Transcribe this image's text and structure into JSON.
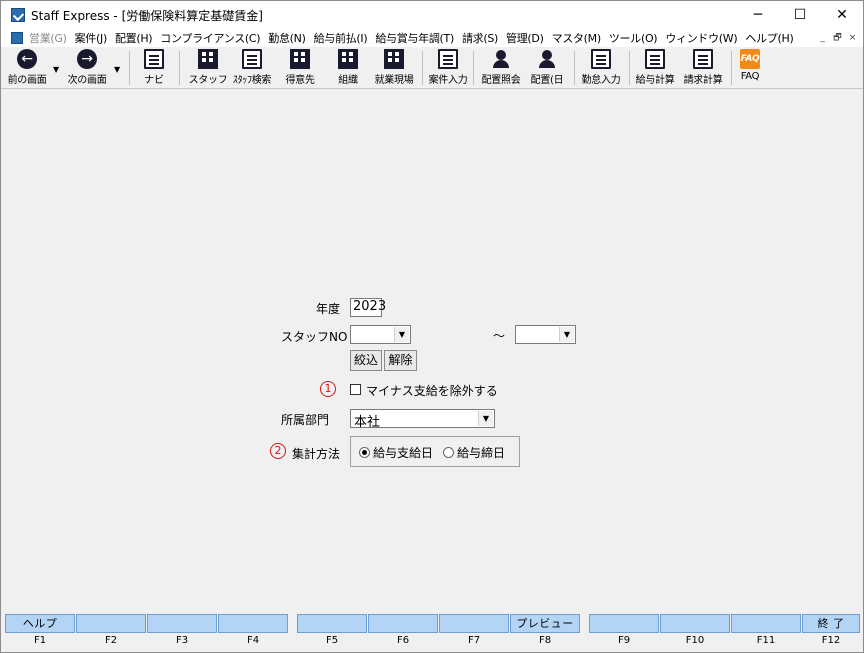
{
  "window": {
    "title": "Staff Express - [労働保険料算定基礎賃金]"
  },
  "window_controls": {
    "minimize": "─",
    "maximize": "☐",
    "close": "✕"
  },
  "mdi_controls": {
    "minimize": "_",
    "restore": "🗗",
    "close": "×"
  },
  "menu": {
    "items": [
      {
        "label": "営業(G)",
        "disabled": true
      },
      {
        "label": "案件(J)"
      },
      {
        "label": "配置(H)"
      },
      {
        "label": "コンプライアンス(C)"
      },
      {
        "label": "勤怠(N)"
      },
      {
        "label": "給与前払(I)"
      },
      {
        "label": "給与賞与年調(T)"
      },
      {
        "label": "請求(S)"
      },
      {
        "label": "管理(D)"
      },
      {
        "label": "マスタ(M)"
      },
      {
        "label": "ツール(O)"
      },
      {
        "label": "ウィンドウ(W)"
      },
      {
        "label": "ヘルプ(H)"
      }
    ]
  },
  "toolbar": {
    "back": "前の画面",
    "forward": "次の画面",
    "navi": "ナビ",
    "staff": "スタッフ",
    "staff_search": "ｽﾀｯﾌ検索",
    "client": "得意先",
    "org": "組織",
    "worksite": "就業現場",
    "case_input": "案件入力",
    "assign_view": "配置照会",
    "assign_day": "配置(日",
    "attendance_input": "勤怠入力",
    "payroll_calc": "給与計算",
    "billing_calc": "請求計算",
    "faq": "FAQ",
    "faq_icon_text": "FAQ",
    "back_icon": "←",
    "forward_icon": "→",
    "dropdown_arrow": "▼"
  },
  "form": {
    "year_label": "年度",
    "year_value": "2023",
    "staff_no_label": "スタッフNO",
    "staff_no_from": "",
    "staff_no_to": "",
    "range_sep": "～",
    "filter_button": "絞込",
    "clear_button": "解除",
    "marker_1": "1",
    "exclude_minus_label": "マイナス支給を除外する",
    "exclude_minus_checked": false,
    "dept_label": "所属部門",
    "dept_value": "本社",
    "marker_2": "2",
    "method_label": "集計方法",
    "method_options": [
      "給与支給日",
      "給与締日"
    ],
    "method_selected": "給与支給日",
    "combo_arrow": "▼"
  },
  "fkeys": [
    {
      "key": "F1",
      "label": "ヘルプ"
    },
    {
      "key": "F2",
      "label": ""
    },
    {
      "key": "F3",
      "label": ""
    },
    {
      "key": "F4",
      "label": ""
    },
    {
      "key": "F5",
      "label": ""
    },
    {
      "key": "F6",
      "label": ""
    },
    {
      "key": "F7",
      "label": ""
    },
    {
      "key": "F8",
      "label": "プレビュー"
    },
    {
      "key": "F9",
      "label": ""
    },
    {
      "key": "F10",
      "label": ""
    },
    {
      "key": "F11",
      "label": ""
    },
    {
      "key": "F12",
      "label": "終 了"
    }
  ]
}
